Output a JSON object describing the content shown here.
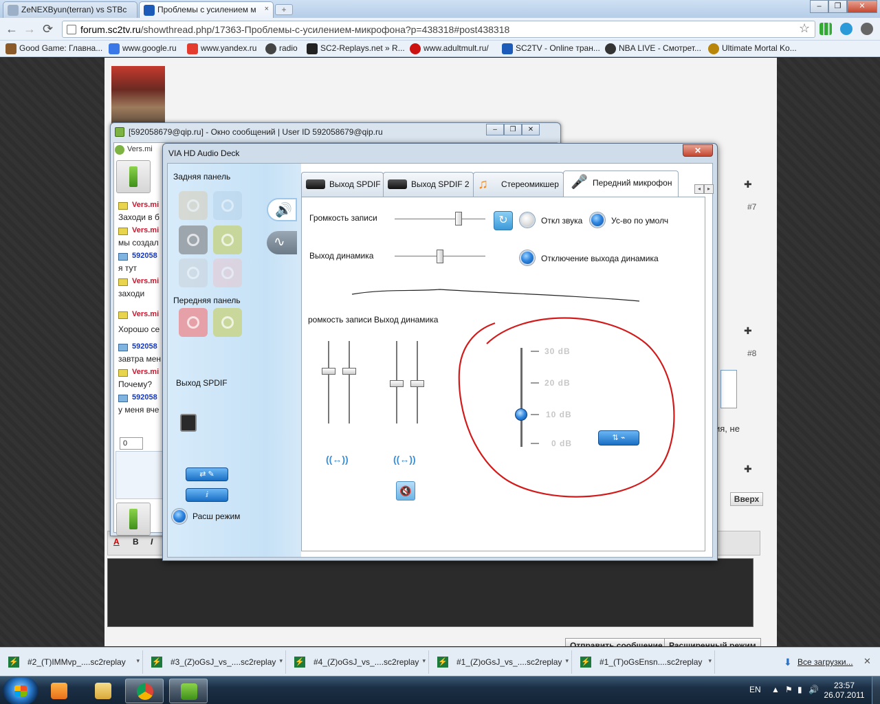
{
  "browser": {
    "tabs": [
      {
        "title": "ZeNEXByun(terran) vs STBc"
      },
      {
        "title": "Проблемы с усилением м"
      }
    ],
    "tab_close": "×",
    "new_tab": "+",
    "window_buttons": {
      "minimize": "–",
      "restore": "❐",
      "close": "✕"
    },
    "nav": {
      "back": "←",
      "forward": "→",
      "reload": "⟳"
    },
    "url_host": "forum.sc2tv.ru",
    "url_path": "/showthread.php/17363-Проблемы-с-усилением-микрофона?p=438318#post438318",
    "star": "☆",
    "bookmarks": [
      {
        "label": "Good Game: Главна...",
        "color": "#8a5a2b"
      },
      {
        "label": "www.google.ru",
        "color": "#3b78e7"
      },
      {
        "label": "www.yandex.ru",
        "color": "#e33b2e"
      },
      {
        "label": "radio",
        "color": "#444444"
      },
      {
        "label": "SC2-Replays.net » R...",
        "color": "#222222"
      },
      {
        "label": "www.adultmult.ru/",
        "color": "#cc1111"
      },
      {
        "label": "SC2TV - Online тран...",
        "color": "#1c5cb8"
      },
      {
        "label": "NBA LIVE - Смотрет...",
        "color": "#333333"
      },
      {
        "label": "Ultimate Mortal Ko...",
        "color": "#b8860b"
      }
    ]
  },
  "forum": {
    "post_numbers": [
      "#7",
      "#8"
    ],
    "top_button": "Вверх",
    "side_text": "ия, не",
    "reply_icon": "✚",
    "editor_tools": [
      "A",
      "B",
      "I"
    ],
    "buttons": {
      "send": "Отправить сообщение",
      "advanced": "Расширенный режим"
    }
  },
  "qip": {
    "title": "[592058679@qip.ru] - Окно сообщений | User ID 592058679@qip.ru",
    "contact_tab": "Vers.mi",
    "counter": "0",
    "chat": [
      {
        "kind": "name-red",
        "text": "Vers.mi"
      },
      {
        "kind": "text",
        "text": "Заходи в б"
      },
      {
        "kind": "name-red",
        "text": "Vers.mi"
      },
      {
        "kind": "text",
        "text": "мы создал"
      },
      {
        "kind": "name-blue",
        "text": "592058"
      },
      {
        "kind": "text",
        "text": "я тут"
      },
      {
        "kind": "name-red",
        "text": "Vers.mi"
      },
      {
        "kind": "text",
        "text": "заходи"
      },
      {
        "kind": "name-red",
        "text": "Vers.mi"
      },
      {
        "kind": "text",
        "text": "Хорошо се"
      },
      {
        "kind": "name-blue",
        "text": "592058"
      },
      {
        "kind": "text",
        "text": "завтра мен"
      },
      {
        "kind": "name-red",
        "text": "Vers.mi"
      },
      {
        "kind": "text",
        "text": "Почему?"
      },
      {
        "kind": "name-blue",
        "text": "592058"
      },
      {
        "kind": "text",
        "text": "у меня вче"
      }
    ]
  },
  "via": {
    "title": "VIA HD Audio Deck",
    "close": "✕",
    "rear_panel": "Задняя панель",
    "front_panel": "Передняя панель",
    "spdif_out": "Выход SPDIF",
    "advanced_mode": "Расш режим",
    "rear_jack_colors": [
      "#d8cdb6",
      "#b7d3ea",
      "#9ea6ad",
      "#c7d79b",
      "#c9d2da",
      "#e8c7cf"
    ],
    "front_jack_colors": [
      "#e6a0a7",
      "#c9d79b"
    ],
    "mode_glyphs": [
      "🔊",
      "∿"
    ],
    "tabs": [
      {
        "label": "Выход SPDIF",
        "icon": "device"
      },
      {
        "label": "Выход SPDIF 2",
        "icon": "device"
      },
      {
        "label": "Стереомикшер",
        "icon": "note"
      },
      {
        "label": "Передний микрофон",
        "icon": "mic"
      }
    ],
    "tab_scroll": [
      "◂",
      "▸"
    ],
    "record_volume": "Громкость записи",
    "speaker_out": "Выход динамика",
    "mute": "Откл звука",
    "default_device": "Ус-во по умолч",
    "speaker_out_off": "Отключение выхода динамика",
    "record_volume_cut": "ромкость записи",
    "speaker_out_2": "Выход динамика",
    "link_glyph": "((↔))",
    "record_level": 0.72,
    "speaker_level": 0.5,
    "boost_levels": [
      "30 dB",
      "20 dB",
      "10 dB",
      "0 dB"
    ],
    "boost_value": "10 dB",
    "radios": {
      "mute": false,
      "default": true,
      "speaker_off": true,
      "advanced": true
    }
  },
  "downloads": {
    "items": [
      "#2_(T)IMMvp_....sc2replay",
      "#3_(Z)oGsJ_vs_....sc2replay",
      "#4_(Z)oGsJ_vs_....sc2replay",
      "#1_(Z)oGsJ_vs_....sc2replay",
      "#1_(T)oGsEnsn....sc2replay"
    ],
    "all": "Все загрузки...",
    "close": "✕",
    "item_icon": "⚡",
    "arrow": "▾"
  },
  "taskbar": {
    "lang": "EN",
    "tray_icons": [
      "▲",
      "⚑",
      "▮",
      "🔊"
    ],
    "time": "23:57",
    "date": "26.07.2011"
  }
}
